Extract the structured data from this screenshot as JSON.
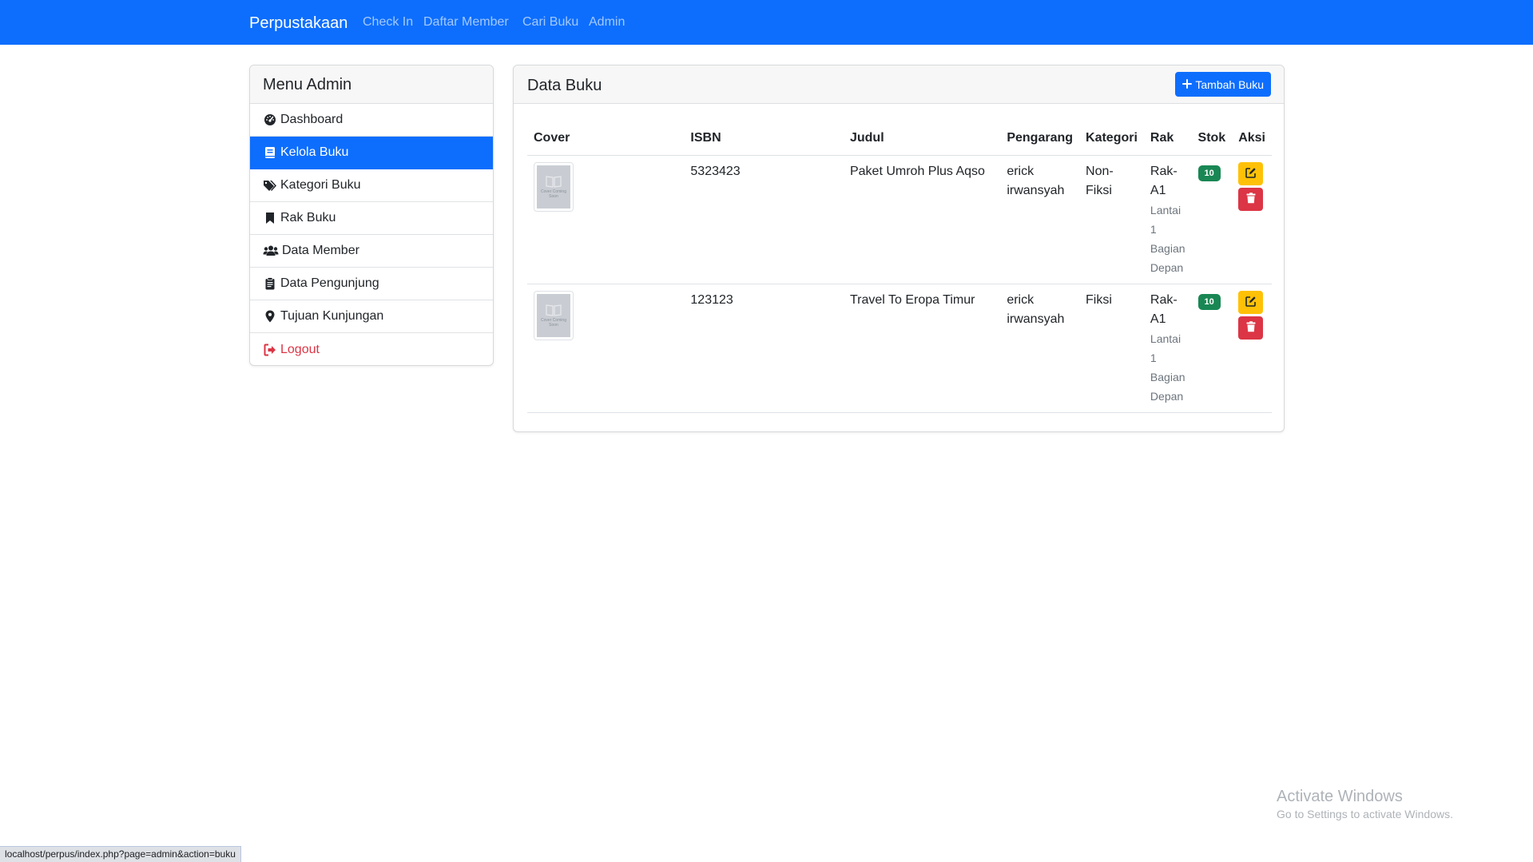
{
  "navbar": {
    "brand": "Perpustakaan",
    "links": [
      "Check In",
      "Daftar Member",
      "Cari Buku",
      "Admin"
    ]
  },
  "sidebar": {
    "title": "Menu Admin",
    "items": [
      {
        "label": "Dashboard",
        "icon": "dashboard-icon"
      },
      {
        "label": "Kelola Buku",
        "icon": "book-icon",
        "active": true
      },
      {
        "label": "Kategori Buku",
        "icon": "tags-icon"
      },
      {
        "label": "Rak Buku",
        "icon": "bookmark-icon"
      },
      {
        "label": "Data Member",
        "icon": "users-icon"
      },
      {
        "label": "Data Pengunjung",
        "icon": "clipboard-icon"
      },
      {
        "label": "Tujuan Kunjungan",
        "icon": "map-marker-icon"
      },
      {
        "label": "Logout",
        "icon": "sign-out-icon",
        "danger": true
      }
    ]
  },
  "main": {
    "title": "Data Buku",
    "add_button": "Tambah Buku",
    "table": {
      "headers": [
        "Cover",
        "ISBN",
        "Judul",
        "Pengarang",
        "Kategori",
        "Rak",
        "Stok",
        "Aksi"
      ],
      "rows": [
        {
          "cover_text": "Cover Coming Soon",
          "isbn": "5323423",
          "judul": "Paket Umroh Plus Aqso",
          "pengarang": "erick irwansyah",
          "kategori": "Non-Fiksi",
          "rak": "Rak-A1",
          "rak_lokasi": "Lantai 1 Bagian Depan",
          "stok": "10"
        },
        {
          "cover_text": "Cover Coming Soon",
          "isbn": "123123",
          "judul": "Travel To Eropa Timur",
          "pengarang": "erick irwansyah",
          "kategori": "Fiksi",
          "rak": "Rak-A1",
          "rak_lokasi": "Lantai 1 Bagian Depan",
          "stok": "10"
        }
      ]
    }
  },
  "watermark": {
    "title": "Activate Windows",
    "subtitle": "Go to Settings to activate Windows."
  },
  "statusbar": {
    "url": "localhost/perpus/index.php?page=admin&action=buku"
  },
  "colors": {
    "primary": "#0d6efd",
    "success": "#198754",
    "warning": "#ffc107",
    "danger": "#dc3545"
  }
}
